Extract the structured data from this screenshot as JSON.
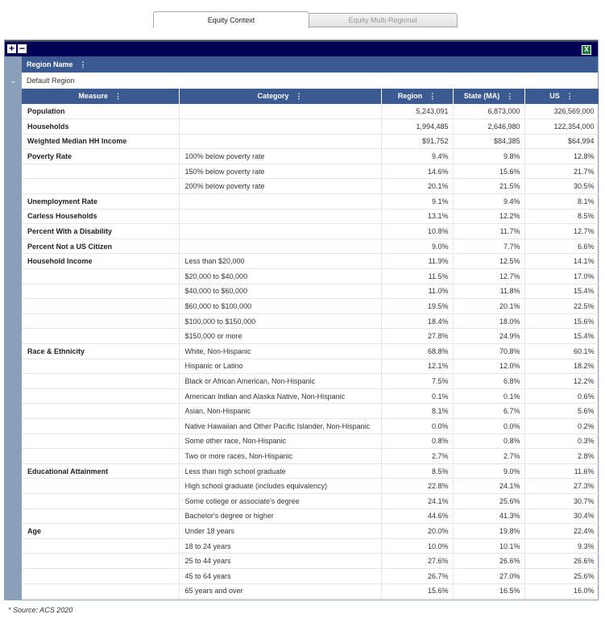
{
  "tabs": [
    {
      "label": "Equity Context",
      "active": true
    },
    {
      "label": "Equity Multi-Regional",
      "active": false
    }
  ],
  "toolbar": {
    "expand": "+",
    "collapse": "−",
    "export": "X"
  },
  "group_header": "Region Name",
  "group_value": "Default Region",
  "columns": [
    "Measure",
    "Category",
    "Region",
    "State (MA)",
    "US"
  ],
  "rows": [
    [
      "Population",
      "",
      "5,243,091",
      "6,873,000",
      "326,569,000"
    ],
    [
      "Households",
      "",
      "1,994,485",
      "2,646,980",
      "122,354,000"
    ],
    [
      "Weighted Median HH Income",
      "",
      "$91,752",
      "$84,385",
      "$64,994"
    ],
    [
      "Poverty Rate",
      "100% below poverty rate",
      "9.4%",
      "9.8%",
      "12.8%"
    ],
    [
      "",
      "150% below poverty rate",
      "14.6%",
      "15.6%",
      "21.7%"
    ],
    [
      "",
      "200% below poverty rate",
      "20.1%",
      "21.5%",
      "30.5%"
    ],
    [
      "Unemployment Rate",
      "",
      "9.1%",
      "9.4%",
      "8.1%"
    ],
    [
      "Carless Households",
      "",
      "13.1%",
      "12.2%",
      "8.5%"
    ],
    [
      "Percent With a Disability",
      "",
      "10.8%",
      "11.7%",
      "12.7%"
    ],
    [
      "Percent Not a US Citizen",
      "",
      "9.0%",
      "7.7%",
      "6.6%"
    ],
    [
      "Household Income",
      "Less than $20,000",
      "11.9%",
      "12.5%",
      "14.1%"
    ],
    [
      "",
      "$20,000 to $40,000",
      "11.5%",
      "12.7%",
      "17.0%"
    ],
    [
      "",
      "$40,000 to $60,000",
      "11.0%",
      "11.8%",
      "15.4%"
    ],
    [
      "",
      "$60,000 to $100,000",
      "19.5%",
      "20.1%",
      "22.5%"
    ],
    [
      "",
      "$100,000 to $150,000",
      "18.4%",
      "18.0%",
      "15.6%"
    ],
    [
      "",
      "$150,000 or more",
      "27.8%",
      "24.9%",
      "15.4%"
    ],
    [
      "Race & Ethnicity",
      "White, Non-Hispanic",
      "68.8%",
      "70.8%",
      "60.1%"
    ],
    [
      "",
      "Hispanic or Latino",
      "12.1%",
      "12.0%",
      "18.2%"
    ],
    [
      "",
      "Black or African American, Non-Hispanic",
      "7.5%",
      "6.8%",
      "12.2%"
    ],
    [
      "",
      "American Indian and Alaska Native, Non-Hispanic",
      "0.1%",
      "0.1%",
      "0.6%"
    ],
    [
      "",
      "Asian, Non-Hispanic",
      "8.1%",
      "6.7%",
      "5.6%"
    ],
    [
      "",
      "Native Hawaiian and Other Pacific Islander, Non-Hispanic",
      "0.0%",
      "0.0%",
      "0.2%"
    ],
    [
      "",
      "Some other race, Non-Hispanic",
      "0.8%",
      "0.8%",
      "0.3%"
    ],
    [
      "",
      "Two or more races, Non-Hispanic",
      "2.7%",
      "2.7%",
      "2.8%"
    ],
    [
      "Educational Attainment",
      "Less than high school graduate",
      "8.5%",
      "9.0%",
      "11.6%"
    ],
    [
      "",
      "High school graduate (includes equivalency)",
      "22.8%",
      "24.1%",
      "27.3%"
    ],
    [
      "",
      "Some college or associate's degree",
      "24.1%",
      "25.6%",
      "30.7%"
    ],
    [
      "",
      "Bachelor's degree or higher",
      "44.6%",
      "41.3%",
      "30.4%"
    ],
    [
      "Age",
      "Under 18 years",
      "20.0%",
      "19.8%",
      "22.4%"
    ],
    [
      "",
      "18 to 24 years",
      "10.0%",
      "10.1%",
      "9.3%"
    ],
    [
      "",
      "25 to 44 years",
      "27.6%",
      "26.6%",
      "26.6%"
    ],
    [
      "",
      "45 to 64 years",
      "26.7%",
      "27.0%",
      "25.6%"
    ],
    [
      "",
      "65 years and over",
      "15.6%",
      "16.5%",
      "16.0%"
    ]
  ],
  "footer": "* Source: ACS 2020",
  "colors": {
    "toolbar": "#000055",
    "header": "#3c5a92",
    "gutter": "#8a9fba"
  }
}
